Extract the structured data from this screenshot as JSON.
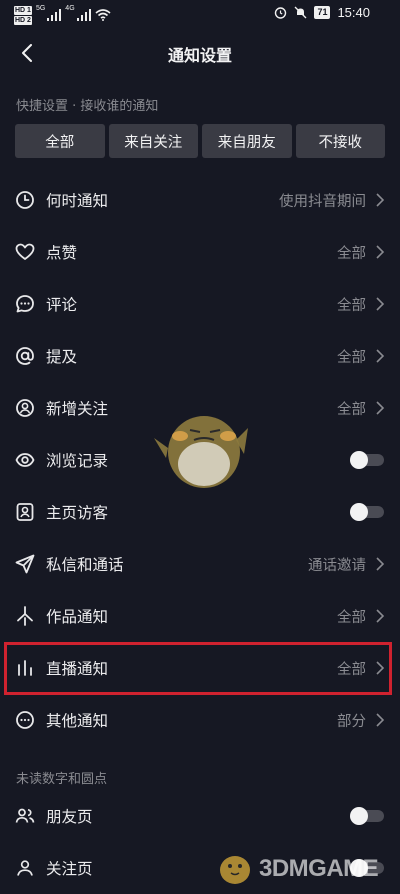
{
  "status_bar": {
    "hd1": "HD 1",
    "hd2": "HD 2",
    "signal1": "5G",
    "signal2": "4G",
    "battery": "71",
    "time": "15:40"
  },
  "header": {
    "title": "通知设置"
  },
  "quick_settings": {
    "title": "快捷设置 · 接收谁的通知",
    "options": [
      "全部",
      "来自关注",
      "来自朋友",
      "不接收"
    ]
  },
  "settings": {
    "rows": [
      {
        "label": "何时通知",
        "value": "使用抖音期间"
      },
      {
        "label": "点赞",
        "value": "全部"
      },
      {
        "label": "评论",
        "value": "全部"
      },
      {
        "label": "提及",
        "value": "全部"
      },
      {
        "label": "新增关注",
        "value": "全部"
      },
      {
        "label": "浏览记录",
        "toggle": false
      },
      {
        "label": "主页访客",
        "toggle": false
      },
      {
        "label": "私信和通话",
        "value": "通话邀请"
      },
      {
        "label": "作品通知",
        "value": "全部"
      },
      {
        "label": "直播通知",
        "value": "全部"
      },
      {
        "label": "其他通知",
        "value": "部分"
      }
    ]
  },
  "unread_section": {
    "title": "未读数字和圆点",
    "rows": [
      {
        "label": "朋友页",
        "toggle": false
      },
      {
        "label": "关注页",
        "toggle": false
      }
    ]
  },
  "highlight_color": "#d0222f",
  "watermark": {
    "text": "3DMGAME"
  }
}
